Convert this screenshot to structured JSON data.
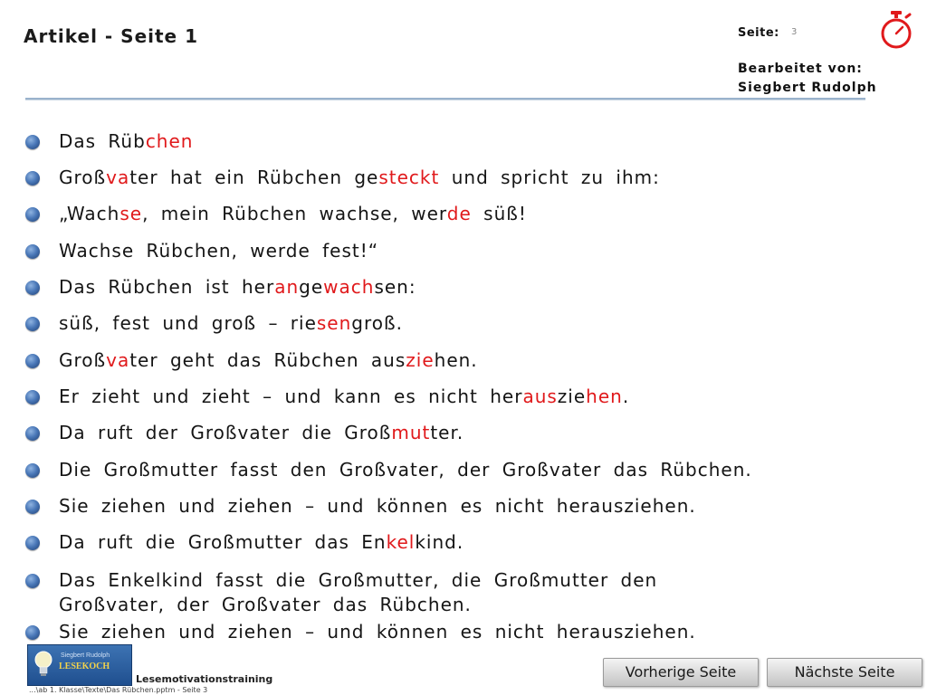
{
  "header": {
    "title": "Artikel - Seite 1",
    "page_label": "Seite:",
    "page_number": "3",
    "editor_label": "Bearbeitet von:",
    "editor_name": "Siegbert Rudolph"
  },
  "lines": [
    {
      "segments": [
        {
          "t": "Das Rüb"
        },
        {
          "t": "chen",
          "red": true
        }
      ]
    },
    {
      "segments": [
        {
          "t": "Groß"
        },
        {
          "t": "va",
          "red": true
        },
        {
          "t": "ter hat ein Rübchen ge"
        },
        {
          "t": "steckt",
          "red": true
        },
        {
          "t": " und spricht zu ihm:"
        }
      ]
    },
    {
      "segments": [
        {
          "t": "„Wach"
        },
        {
          "t": "se",
          "red": true
        },
        {
          "t": ", mein Rübchen wachse, wer"
        },
        {
          "t": "de",
          "red": true
        },
        {
          "t": " süß!"
        }
      ]
    },
    {
      "segments": [
        {
          "t": "Wachse Rübchen, werde fest!“"
        }
      ]
    },
    {
      "segments": [
        {
          "t": "Das Rübchen ist her"
        },
        {
          "t": "an",
          "red": true
        },
        {
          "t": "ge"
        },
        {
          "t": "wach",
          "red": true
        },
        {
          "t": "sen:"
        }
      ]
    },
    {
      "segments": [
        {
          "t": "süß, fest und groß – rie"
        },
        {
          "t": "sen",
          "red": true
        },
        {
          "t": "groß."
        }
      ]
    },
    {
      "segments": [
        {
          "t": "Groß"
        },
        {
          "t": "va",
          "red": true
        },
        {
          "t": "ter geht das Rübchen aus"
        },
        {
          "t": "zie",
          "red": true
        },
        {
          "t": "hen."
        }
      ]
    },
    {
      "segments": [
        {
          "t": "Er zieht und zieht – und kann es nicht her"
        },
        {
          "t": "aus",
          "red": true
        },
        {
          "t": "zie"
        },
        {
          "t": "hen",
          "red": true
        },
        {
          "t": "."
        }
      ]
    },
    {
      "segments": [
        {
          "t": "Da ruft der Großvater die Groß"
        },
        {
          "t": "mut",
          "red": true
        },
        {
          "t": "ter."
        }
      ]
    },
    {
      "segments": [
        {
          "t": "Die Großmutter fasst den Großvater, der Großvater das Rübchen."
        }
      ]
    },
    {
      "segments": [
        {
          "t": "Sie ziehen und ziehen – und können es nicht herausziehen."
        }
      ]
    },
    {
      "segments": [
        {
          "t": "Da ruft die Großmutter das En"
        },
        {
          "t": "kel",
          "red": true
        },
        {
          "t": "kind."
        }
      ]
    },
    {
      "segments": [
        {
          "t": "Das Enkelkind fasst die Großmutter, die Großmutter den Großvater, der Großvater das Rübchen."
        }
      ]
    },
    {
      "segments": [
        {
          "t": "Sie ziehen und ziehen – und können es nicht herausziehen."
        }
      ]
    }
  ],
  "footer": {
    "logo_name": "Siegbert Rudolph",
    "logo_brand": "LESEKOCH",
    "label": "Lesemotivationstraining",
    "path": "...\\ab 1. Klasse\\Texte\\Das Rübchen.pptm - Seite 3"
  },
  "nav": {
    "prev_label": "Vorherige Seite",
    "next_label": "Nächste Seite"
  },
  "colors": {
    "highlight": "#e0191b",
    "bullet": "#4a78b8",
    "rule": "#9ab3cc"
  },
  "icons": {
    "timer": "stopwatch-icon",
    "bullet": "circle-bullet-icon",
    "logo": "lightbulb-logo-icon"
  }
}
